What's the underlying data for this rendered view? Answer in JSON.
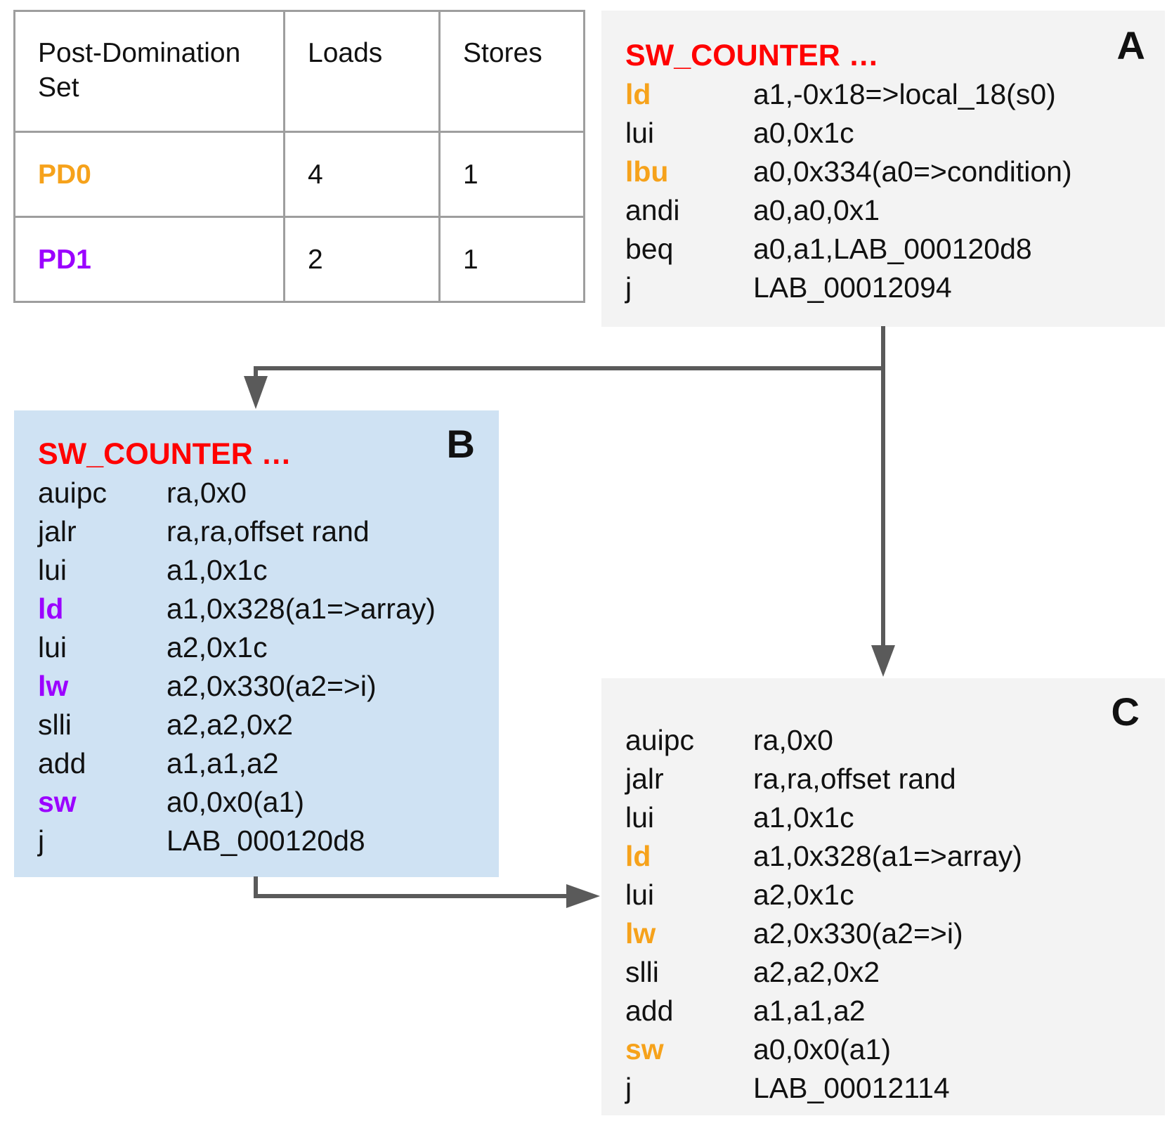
{
  "colors": {
    "function_name": "#ff0000",
    "pd0": "#f6a21b",
    "pd1": "#9b00ff",
    "arrow": "#5a5a5a",
    "block_gray": "#f3f3f3",
    "block_blue": "#cfe2f3",
    "table_border": "#9e9e9e"
  },
  "table": {
    "headers": [
      "Post-Domination\nSet",
      "Loads",
      "Stores"
    ],
    "rows": [
      {
        "set": "PD0",
        "loads": "4",
        "stores": "1",
        "color": "#f6a21b"
      },
      {
        "set": "PD1",
        "loads": "2",
        "stores": "1",
        "color": "#9b00ff"
      }
    ]
  },
  "blocks": {
    "a": {
      "label": "A",
      "function": "SW_COUNTER …",
      "instructions": [
        {
          "op": "ld",
          "args": "a1,-0x18=>local_18(s0)",
          "color": "#f6a21b"
        },
        {
          "op": "lui",
          "args": "a0,0x1c",
          "color": ""
        },
        {
          "op": "lbu",
          "args": "a0,0x334(a0=>condition)",
          "color": "#f6a21b"
        },
        {
          "op": "andi",
          "args": "a0,a0,0x1",
          "color": ""
        },
        {
          "op": "beq",
          "args": "a0,a1,LAB_000120d8",
          "color": ""
        },
        {
          "op": "j",
          "args": "LAB_00012094",
          "color": ""
        }
      ]
    },
    "b": {
      "label": "B",
      "function": "SW_COUNTER …",
      "instructions": [
        {
          "op": "auipc",
          "args": "ra,0x0",
          "color": ""
        },
        {
          "op": "jalr",
          "args": "ra,ra,offset rand",
          "color": ""
        },
        {
          "op": "lui",
          "args": "a1,0x1c",
          "color": ""
        },
        {
          "op": "ld",
          "args": "a1,0x328(a1=>array)",
          "color": "#9b00ff"
        },
        {
          "op": "lui",
          "args": "a2,0x1c",
          "color": ""
        },
        {
          "op": "lw",
          "args": "a2,0x330(a2=>i)",
          "color": "#9b00ff"
        },
        {
          "op": "slli",
          "args": "a2,a2,0x2",
          "color": ""
        },
        {
          "op": "add",
          "args": "a1,a1,a2",
          "color": ""
        },
        {
          "op": "sw",
          "args": "a0,0x0(a1)",
          "color": "#9b00ff"
        },
        {
          "op": "j",
          "args": "LAB_000120d8",
          "color": ""
        }
      ]
    },
    "c": {
      "label": "C",
      "instructions": [
        {
          "op": "auipc",
          "args": "ra,0x0",
          "color": ""
        },
        {
          "op": "jalr",
          "args": "ra,ra,offset rand",
          "color": ""
        },
        {
          "op": "lui",
          "args": "a1,0x1c",
          "color": ""
        },
        {
          "op": "ld",
          "args": "a1,0x328(a1=>array)",
          "color": "#f6a21b"
        },
        {
          "op": "lui",
          "args": "a2,0x1c",
          "color": ""
        },
        {
          "op": "lw",
          "args": "a2,0x330(a2=>i)",
          "color": "#f6a21b"
        },
        {
          "op": "slli",
          "args": "a2,a2,0x2",
          "color": ""
        },
        {
          "op": "add",
          "args": "a1,a1,a2",
          "color": ""
        },
        {
          "op": "sw",
          "args": "a0,0x0(a1)",
          "color": "#f6a21b"
        },
        {
          "op": "j",
          "args": "LAB_00012114",
          "color": ""
        }
      ]
    }
  }
}
